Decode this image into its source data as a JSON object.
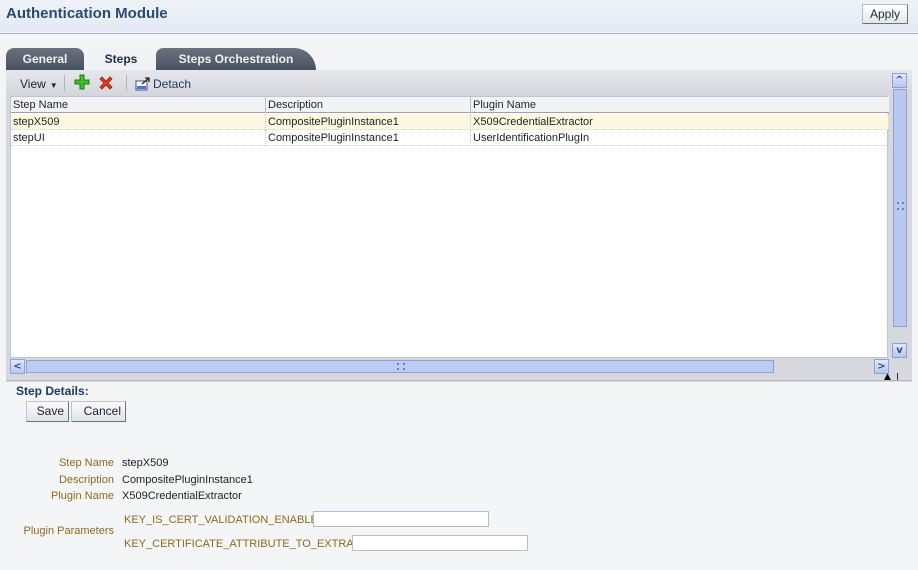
{
  "header": {
    "title": "Authentication Module",
    "apply_label": "Apply"
  },
  "tabs": [
    {
      "label": "General",
      "active": false
    },
    {
      "label": "Steps",
      "active": true
    },
    {
      "label": "Steps Orchestration",
      "active": false
    }
  ],
  "toolbar": {
    "view_label": "View",
    "add_icon": "add-icon",
    "delete_icon": "delete-icon",
    "detach_icon": "detach-icon",
    "detach_label": "Detach"
  },
  "table": {
    "columns": [
      "Step Name",
      "Description",
      "Plugin Name"
    ],
    "rows": [
      {
        "step_name": "stepX509",
        "description": "CompositePluginInstance1",
        "plugin_name": "X509CredentialExtractor",
        "selected": true
      },
      {
        "step_name": "stepUI",
        "description": "CompositePluginInstance1",
        "plugin_name": "UserIdentificationPlugIn",
        "selected": false
      }
    ]
  },
  "details": {
    "title": "Step Details:",
    "save_label": "Save",
    "cancel_label": "Cancel",
    "fields": {
      "step_name_label": "Step Name",
      "step_name_value": "stepX509",
      "description_label": "Description",
      "description_value": "CompositePluginInstance1",
      "plugin_name_label": "Plugin Name",
      "plugin_name_value": "X509CredentialExtractor",
      "plugin_parameters_label": "Plugin Parameters"
    },
    "parameters": [
      {
        "key": "KEY_IS_CERT_VALIDATION_ENABLED",
        "value": ""
      },
      {
        "key": "KEY_CERTIFICATE_ATTRIBUTE_TO_EXTRACT",
        "value": ""
      }
    ]
  },
  "colors": {
    "title": "#2b4a6f",
    "label": "#8a6a1e",
    "selected_row": "#fff8e1",
    "scrollbar": "#b8c8f0"
  }
}
